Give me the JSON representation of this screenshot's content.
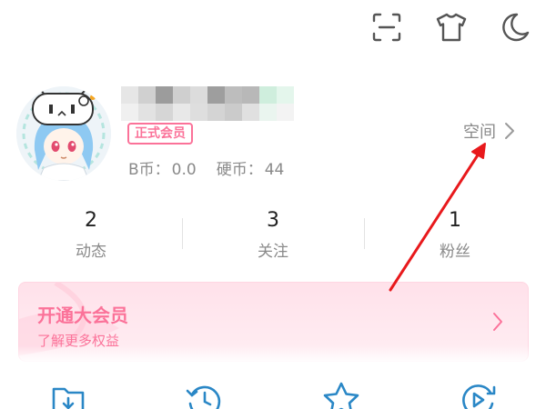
{
  "topbar": {
    "icons": [
      "scan-icon",
      "tshirt-icon",
      "moon-icon"
    ]
  },
  "profile": {
    "vip_badge": "正式会员",
    "bcoin_label": "B币：",
    "bcoin_value": "0.0",
    "coin_label": "硬币：",
    "coin_value": "44",
    "space_label": "空间"
  },
  "stats": [
    {
      "count": "2",
      "label": "动态"
    },
    {
      "count": "3",
      "label": "关注"
    },
    {
      "count": "1",
      "label": "粉丝"
    }
  ],
  "vip_banner": {
    "title": "开通大会员",
    "subtitle": "了解更多权益"
  },
  "quick_actions": [
    "download-icon",
    "history-icon",
    "favorite-icon",
    "watch-later-icon"
  ],
  "colors": {
    "accent_pink": "#fb7299",
    "icon_blue": "#2a87c6",
    "annotation_red": "#e8191c"
  }
}
